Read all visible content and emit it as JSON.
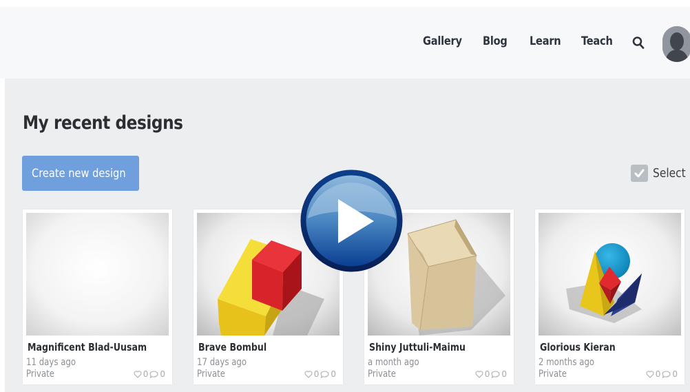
{
  "nav": {
    "items": [
      "Gallery",
      "Blog",
      "Learn",
      "Teach"
    ]
  },
  "main": {
    "title": "My recent designs",
    "create_label": "Create new design",
    "select_label": "Select"
  },
  "designs": [
    {
      "name": "Magnificent Blad-Uusam",
      "time": "11 days ago",
      "visibility": "Private",
      "likes": "0",
      "comments": "0"
    },
    {
      "name": "Brave Bombul",
      "time": "17 days ago",
      "visibility": "Private",
      "likes": "0",
      "comments": "0"
    },
    {
      "name": "Shiny Juttuli-Maimu",
      "time": "a month ago",
      "visibility": "Private",
      "likes": "0",
      "comments": "0"
    },
    {
      "name": "Glorious Kieran",
      "time": "2 months ago",
      "visibility": "Private",
      "likes": "0",
      "comments": "0"
    }
  ],
  "colors": {
    "accent": "#6f9fdc",
    "page_background": "#eceeef",
    "header_background": "#f7f8f9"
  },
  "icons": [
    "search-icon",
    "avatar",
    "checkbox-icon",
    "heart-icon",
    "comment-icon",
    "play-icon"
  ]
}
